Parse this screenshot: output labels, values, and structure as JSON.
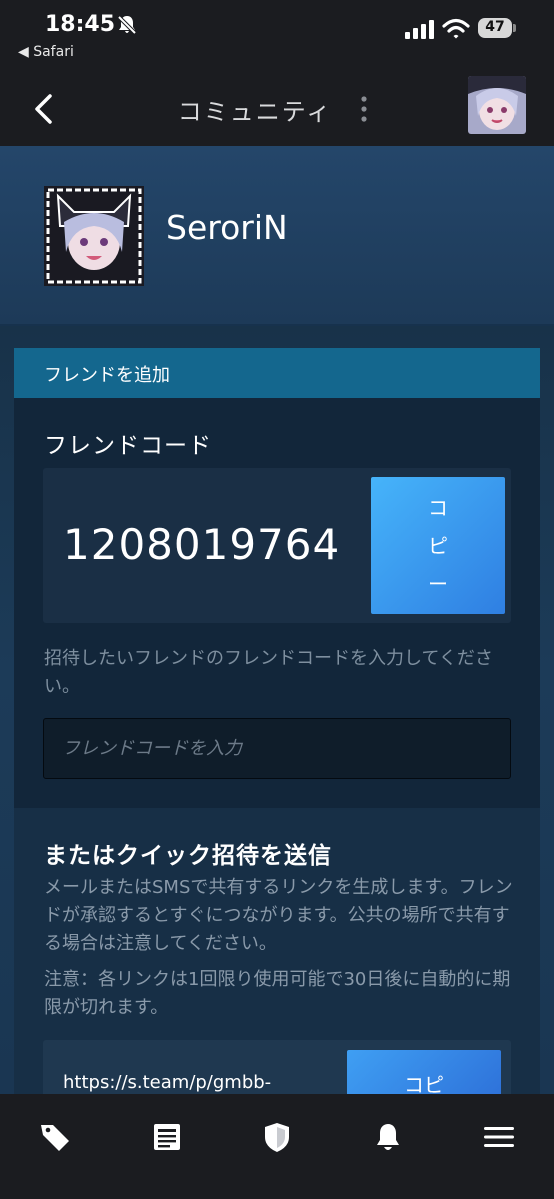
{
  "status_bar": {
    "time": "18:45",
    "back_app": "◀ Safari",
    "battery_level": "47",
    "icons": [
      "bell-off-icon",
      "signal-icon",
      "wifi-icon",
      "battery-icon"
    ]
  },
  "header": {
    "title": "コミュニティ",
    "icons": [
      "back-chevron-icon",
      "more-vertical-icon"
    ]
  },
  "profile": {
    "name": "SeroriN"
  },
  "add_friend": {
    "header": "フレンドを追加",
    "code_label": "フレンドコード",
    "code_value": "1208019764",
    "copy_label_chars": [
      "コ",
      "ピ",
      "ー"
    ],
    "help_text": "招待したいフレンドのフレンドコードを入力してください。",
    "input_placeholder": "フレンドコードを入力"
  },
  "quick_invite": {
    "title": "またはクイック招待を送信",
    "description": "メールまたはSMSで共有するリンクを生成します。フレンドが承認するとすぐにつながります。公共の場所で共有する場合は注意してください。",
    "note": "注意：各リンクは1回限り使用可能で30日後に自動的に期限が切れます。",
    "link": "https://s.team/p/gmbb-",
    "copy_label": "コピ"
  },
  "tab_bar": {
    "items": [
      "tag-icon",
      "news-icon",
      "shield-icon",
      "bell-icon",
      "menu-icon"
    ]
  },
  "colors": {
    "accent": "#14678e",
    "button": "#3a9cf0",
    "bar_bg": "#1b1c20"
  }
}
